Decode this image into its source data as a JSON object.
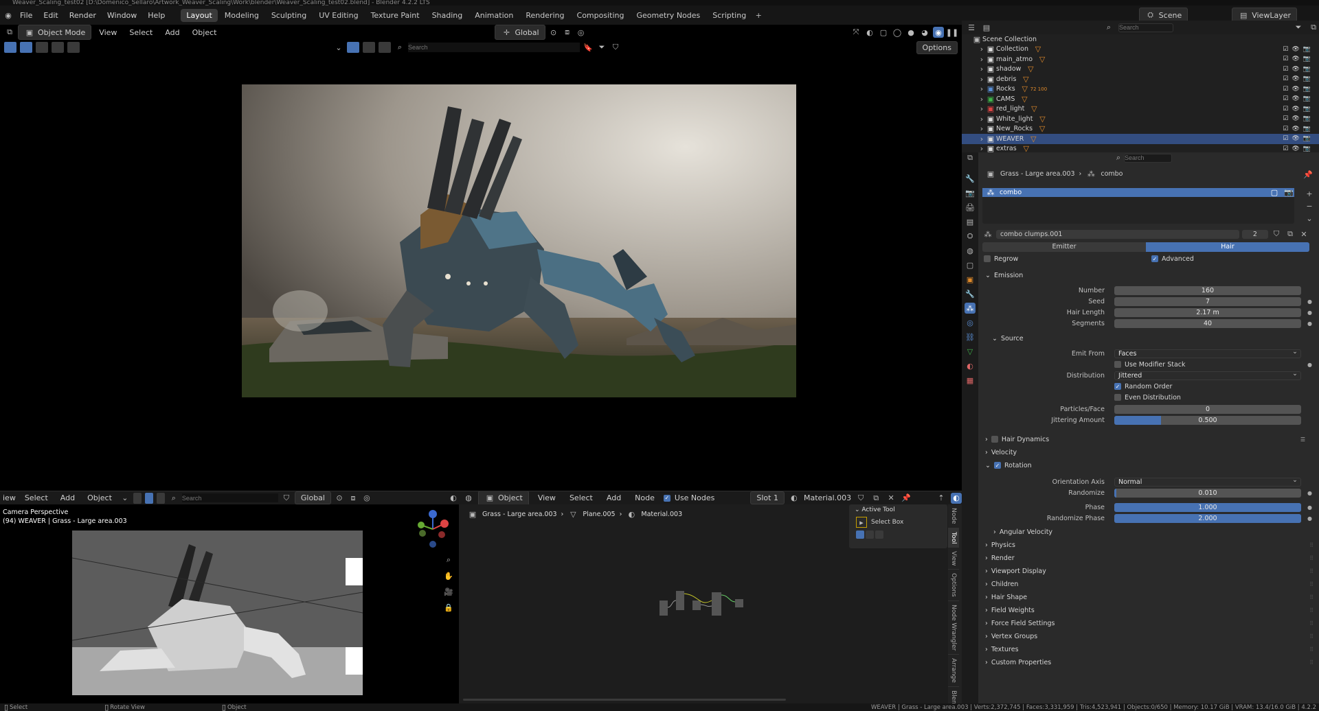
{
  "title": "Weaver_Scaling_test02 [D:\\Domenico_Sellaro\\Artwork_Weaver_Scaling\\Work\\blender\\Weaver_Scaling_test02.blend] - Blender 4.2.2 LTS",
  "menu": [
    "File",
    "Edit",
    "Render",
    "Window",
    "Help"
  ],
  "workspaces": [
    "Layout",
    "Modeling",
    "Sculpting",
    "UV Editing",
    "Texture Paint",
    "Shading",
    "Animation",
    "Rendering",
    "Compositing",
    "Geometry Nodes",
    "Scripting"
  ],
  "active_workspace": "Layout",
  "scene": {
    "label": "Scene",
    "view_layer": "ViewLayer"
  },
  "viewport": {
    "mode": "Object Mode",
    "menus": [
      "View",
      "Select",
      "Add",
      "Object"
    ],
    "transform": "Global",
    "search_placeholder": "Search",
    "options": "Options"
  },
  "cam_view": {
    "menus": [
      "iew",
      "Select",
      "Add",
      "Object"
    ],
    "transform": "Global",
    "search_placeholder": "Search",
    "line1": "Camera Perspective",
    "line2": "(94) WEAVER | Grass - Large area.003"
  },
  "node_editor": {
    "type": "Object",
    "menus": [
      "View",
      "Select",
      "Add",
      "Node"
    ],
    "use_nodes": "Use Nodes",
    "slot": "Slot 1",
    "material": "Material.003",
    "breadcrumb": [
      "Grass - Large area.003",
      "Plane.005",
      "Material.003"
    ],
    "active_tool_header": "Active Tool",
    "active_tool": "Select Box",
    "side_tabs": [
      "Node",
      "Tool",
      "View",
      "Options",
      "Node Wrangler",
      "Arrange",
      "Blen"
    ]
  },
  "outliner": {
    "search_placeholder": "Search",
    "root": "Scene Collection",
    "items": [
      {
        "name": "Collection"
      },
      {
        "name": "main_atmo"
      },
      {
        "name": "shadow"
      },
      {
        "name": "debris"
      },
      {
        "name": "Rocks",
        "badge": "72 100"
      },
      {
        "name": "CAMS"
      },
      {
        "name": "red_light"
      },
      {
        "name": "White_light"
      },
      {
        "name": "New_Rocks"
      },
      {
        "name": "WEAVER",
        "selected": true
      },
      {
        "name": "extras"
      }
    ]
  },
  "properties": {
    "search_placeholder": "Search",
    "breadcrumb": [
      "Grass - Large area.003",
      "combo"
    ],
    "system": "combo",
    "settings_name": "combo clumps.001",
    "users": "2",
    "type_tabs": [
      "Emitter",
      "Hair"
    ],
    "active_type": "Hair",
    "regrow": "Regrow",
    "advanced": "Advanced",
    "emission": {
      "header": "Emission",
      "fields": [
        {
          "label": "Number",
          "value": "160"
        },
        {
          "label": "Seed",
          "value": "7"
        },
        {
          "label": "Hair Length",
          "value": "2.17 m"
        },
        {
          "label": "Segments",
          "value": "40"
        }
      ]
    },
    "source": {
      "header": "Source",
      "emit_from_label": "Emit From",
      "emit_from": "Faces",
      "use_modifier_stack": "Use Modifier Stack",
      "distribution_label": "Distribution",
      "distribution": "Jittered",
      "random_order": "Random Order",
      "even_distribution": "Even Distribution",
      "particles_face_label": "Particles/Face",
      "particles_face": "0",
      "jittering_label": "Jittering Amount",
      "jittering": "0.500",
      "jittering_fraction": 0.25
    },
    "hair_dynamics": "Hair Dynamics",
    "velocity": "Velocity",
    "rotation": {
      "header": "Rotation",
      "axis_label": "Orientation Axis",
      "axis": "Normal",
      "randomize_label": "Randomize",
      "randomize": "0.010",
      "randomize_fraction": 0.01,
      "phase_label": "Phase",
      "phase": "1.000",
      "phase_fraction": 1.0,
      "randomize_phase_label": "Randomize Phase",
      "randomize_phase": "2.000",
      "randomize_phase_fraction": 1.0,
      "angular_velocity": "Angular Velocity"
    },
    "panels": [
      "Physics",
      "Render",
      "Viewport Display",
      "Children",
      "Hair Shape",
      "Field Weights",
      "Force Field Settings",
      "Vertex Groups",
      "Textures",
      "Custom Properties"
    ]
  },
  "status": {
    "left": [
      "Select",
      "Rotate View",
      "Object"
    ],
    "right": "WEAVER | Grass - Large area.003 | Verts:2,372,745 | Faces:3,331,959 | Tris:4,523,941 | Objects:0/650 | Memory: 10.17 GiB | VRAM: 13.4/16.0 GiB | 4.2.2"
  }
}
